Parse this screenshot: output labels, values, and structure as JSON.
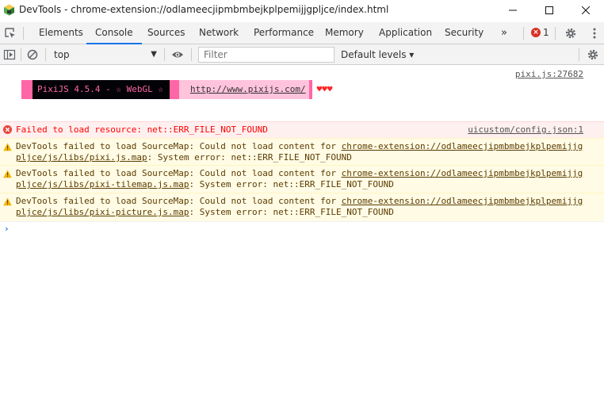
{
  "window": {
    "title": "DevTools - chrome-extension://odlameecjipmbmbejkplpemijjgpljce/index.html"
  },
  "tabs": [
    {
      "label": "Elements",
      "active": false
    },
    {
      "label": "Console",
      "active": true
    },
    {
      "label": "Sources",
      "active": false
    },
    {
      "label": "Network",
      "active": false
    },
    {
      "label": "Performance",
      "active": false
    },
    {
      "label": "Memory",
      "active": false
    },
    {
      "label": "Application",
      "active": false
    },
    {
      "label": "Security",
      "active": false
    }
  ],
  "tabbar": {
    "more_label": "»",
    "error_count": "1"
  },
  "toolbar": {
    "context": "top",
    "filter_placeholder": "Filter",
    "levels_label": "Default levels ▾"
  },
  "console": {
    "pixi": {
      "source": "pixi.js:27682",
      "banner_text": "PixiJS 4.5.4 - ☆ WebGL ☆",
      "banner_link": "http://www.pixijs.com/",
      "hearts": "♥♥♥"
    },
    "messages": [
      {
        "level": "error",
        "text": "Failed to load resource: net::ERR_FILE_NOT_FOUND",
        "source": "uicustom/config.json:1"
      },
      {
        "level": "warning",
        "prefix": "DevTools failed to load SourceMap: Could not load content for ",
        "link": "chrome-extension://odlameecjipmbmbejkplpemijjgpljce/js/libs/pixi.js.map",
        "suffix": ": System error: net::ERR_FILE_NOT_FOUND"
      },
      {
        "level": "warning",
        "prefix": "DevTools failed to load SourceMap: Could not load content for ",
        "link": "chrome-extension://odlameecjipmbmbejkplpemijjgpljce/js/libs/pixi-tilemap.js.map",
        "suffix": ": System error: net::ERR_FILE_NOT_FOUND"
      },
      {
        "level": "warning",
        "prefix": "DevTools failed to load SourceMap: Could not load content for ",
        "link": "chrome-extension://odlameecjipmbmbejkplpemijjgpljce/js/libs/pixi-picture.js.map",
        "suffix": ": System error: net::ERR_FILE_NOT_FOUND"
      }
    ],
    "prompt": "›"
  },
  "colors": {
    "accent": "#1a73e8",
    "error_bg": "#fff0f0",
    "warning_bg": "#fffbe5",
    "pixi_pink": "#ff66a5"
  }
}
